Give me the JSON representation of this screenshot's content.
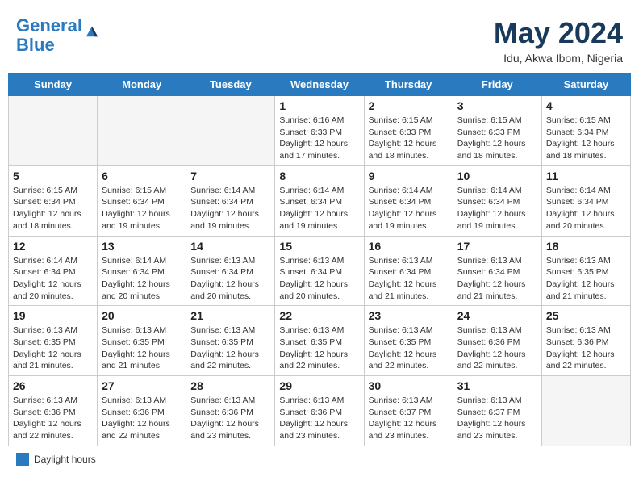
{
  "header": {
    "logo_line1": "General",
    "logo_line2": "Blue",
    "month": "May 2024",
    "location": "Idu, Akwa Ibom, Nigeria"
  },
  "days_of_week": [
    "Sunday",
    "Monday",
    "Tuesday",
    "Wednesday",
    "Thursday",
    "Friday",
    "Saturday"
  ],
  "legend": {
    "label": "Daylight hours"
  },
  "weeks": [
    [
      {
        "day": "",
        "info": ""
      },
      {
        "day": "",
        "info": ""
      },
      {
        "day": "",
        "info": ""
      },
      {
        "day": "1",
        "info": "Sunrise: 6:16 AM\nSunset: 6:33 PM\nDaylight: 12 hours\nand 17 minutes."
      },
      {
        "day": "2",
        "info": "Sunrise: 6:15 AM\nSunset: 6:33 PM\nDaylight: 12 hours\nand 18 minutes."
      },
      {
        "day": "3",
        "info": "Sunrise: 6:15 AM\nSunset: 6:33 PM\nDaylight: 12 hours\nand 18 minutes."
      },
      {
        "day": "4",
        "info": "Sunrise: 6:15 AM\nSunset: 6:34 PM\nDaylight: 12 hours\nand 18 minutes."
      }
    ],
    [
      {
        "day": "5",
        "info": "Sunrise: 6:15 AM\nSunset: 6:34 PM\nDaylight: 12 hours\nand 18 minutes."
      },
      {
        "day": "6",
        "info": "Sunrise: 6:15 AM\nSunset: 6:34 PM\nDaylight: 12 hours\nand 19 minutes."
      },
      {
        "day": "7",
        "info": "Sunrise: 6:14 AM\nSunset: 6:34 PM\nDaylight: 12 hours\nand 19 minutes."
      },
      {
        "day": "8",
        "info": "Sunrise: 6:14 AM\nSunset: 6:34 PM\nDaylight: 12 hours\nand 19 minutes."
      },
      {
        "day": "9",
        "info": "Sunrise: 6:14 AM\nSunset: 6:34 PM\nDaylight: 12 hours\nand 19 minutes."
      },
      {
        "day": "10",
        "info": "Sunrise: 6:14 AM\nSunset: 6:34 PM\nDaylight: 12 hours\nand 19 minutes."
      },
      {
        "day": "11",
        "info": "Sunrise: 6:14 AM\nSunset: 6:34 PM\nDaylight: 12 hours\nand 20 minutes."
      }
    ],
    [
      {
        "day": "12",
        "info": "Sunrise: 6:14 AM\nSunset: 6:34 PM\nDaylight: 12 hours\nand 20 minutes."
      },
      {
        "day": "13",
        "info": "Sunrise: 6:14 AM\nSunset: 6:34 PM\nDaylight: 12 hours\nand 20 minutes."
      },
      {
        "day": "14",
        "info": "Sunrise: 6:13 AM\nSunset: 6:34 PM\nDaylight: 12 hours\nand 20 minutes."
      },
      {
        "day": "15",
        "info": "Sunrise: 6:13 AM\nSunset: 6:34 PM\nDaylight: 12 hours\nand 20 minutes."
      },
      {
        "day": "16",
        "info": "Sunrise: 6:13 AM\nSunset: 6:34 PM\nDaylight: 12 hours\nand 21 minutes."
      },
      {
        "day": "17",
        "info": "Sunrise: 6:13 AM\nSunset: 6:34 PM\nDaylight: 12 hours\nand 21 minutes."
      },
      {
        "day": "18",
        "info": "Sunrise: 6:13 AM\nSunset: 6:35 PM\nDaylight: 12 hours\nand 21 minutes."
      }
    ],
    [
      {
        "day": "19",
        "info": "Sunrise: 6:13 AM\nSunset: 6:35 PM\nDaylight: 12 hours\nand 21 minutes."
      },
      {
        "day": "20",
        "info": "Sunrise: 6:13 AM\nSunset: 6:35 PM\nDaylight: 12 hours\nand 21 minutes."
      },
      {
        "day": "21",
        "info": "Sunrise: 6:13 AM\nSunset: 6:35 PM\nDaylight: 12 hours\nand 22 minutes."
      },
      {
        "day": "22",
        "info": "Sunrise: 6:13 AM\nSunset: 6:35 PM\nDaylight: 12 hours\nand 22 minutes."
      },
      {
        "day": "23",
        "info": "Sunrise: 6:13 AM\nSunset: 6:35 PM\nDaylight: 12 hours\nand 22 minutes."
      },
      {
        "day": "24",
        "info": "Sunrise: 6:13 AM\nSunset: 6:36 PM\nDaylight: 12 hours\nand 22 minutes."
      },
      {
        "day": "25",
        "info": "Sunrise: 6:13 AM\nSunset: 6:36 PM\nDaylight: 12 hours\nand 22 minutes."
      }
    ],
    [
      {
        "day": "26",
        "info": "Sunrise: 6:13 AM\nSunset: 6:36 PM\nDaylight: 12 hours\nand 22 minutes."
      },
      {
        "day": "27",
        "info": "Sunrise: 6:13 AM\nSunset: 6:36 PM\nDaylight: 12 hours\nand 22 minutes."
      },
      {
        "day": "28",
        "info": "Sunrise: 6:13 AM\nSunset: 6:36 PM\nDaylight: 12 hours\nand 23 minutes."
      },
      {
        "day": "29",
        "info": "Sunrise: 6:13 AM\nSunset: 6:36 PM\nDaylight: 12 hours\nand 23 minutes."
      },
      {
        "day": "30",
        "info": "Sunrise: 6:13 AM\nSunset: 6:37 PM\nDaylight: 12 hours\nand 23 minutes."
      },
      {
        "day": "31",
        "info": "Sunrise: 6:13 AM\nSunset: 6:37 PM\nDaylight: 12 hours\nand 23 minutes."
      },
      {
        "day": "",
        "info": ""
      }
    ]
  ]
}
